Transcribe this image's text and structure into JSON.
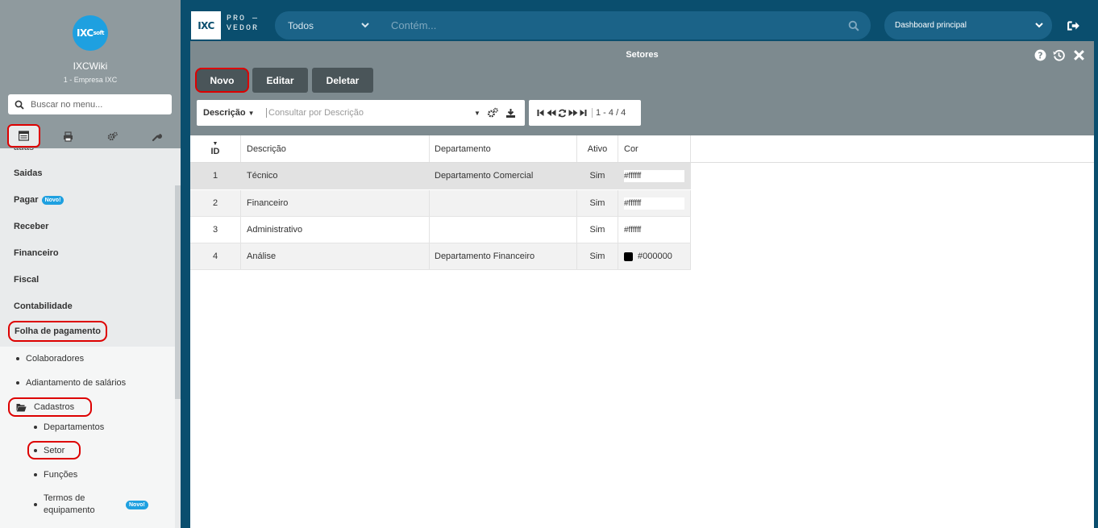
{
  "sidebar": {
    "logo_text": "IXC",
    "logo_suffix": "soft",
    "app_name": "IXCWiki",
    "company": "1 - Empresa IXC",
    "search_placeholder": "Buscar no menu...",
    "menu_items": [
      {
        "label": "Saidas"
      },
      {
        "label": "Pagar",
        "badge": "Novo!"
      },
      {
        "label": "Receber"
      },
      {
        "label": "Financeiro"
      },
      {
        "label": "Fiscal"
      },
      {
        "label": "Contabilidade"
      },
      {
        "label": "Folha de pagamento"
      }
    ],
    "folha_sub": [
      {
        "label": "Colaboradores"
      },
      {
        "label": "Adiantamento de salários"
      }
    ],
    "cadastros_label": "Cadastros",
    "cadastros_sub": [
      {
        "label": "Departamentos"
      },
      {
        "label": "Setor"
      },
      {
        "label": "Funções"
      },
      {
        "label": "Termos de equipamento",
        "badge": "Novo!"
      }
    ]
  },
  "header": {
    "brand": "IXC",
    "brand_sub_1": "PRO —",
    "brand_sub_2": "VEDOR",
    "scope": "Todos",
    "search_placeholder": "Contém...",
    "dashboard": "Dashboard principal"
  },
  "window": {
    "title": "Setores",
    "buttons": {
      "new": "Novo",
      "edit": "Editar",
      "delete": "Deletar"
    },
    "filter_field": "Descrição",
    "filter_placeholder": "Consultar por Descrição",
    "pager_text": "1 - 4 / 4"
  },
  "table": {
    "columns": [
      "ID",
      "Descrição",
      "Departamento",
      "Ativo",
      "Cor"
    ],
    "rows": [
      {
        "id": "1",
        "descricao": "Técnico",
        "departamento": "Departamento Comercial",
        "ativo": "Sim",
        "cor": "#ffffff"
      },
      {
        "id": "2",
        "descricao": "Financeiro",
        "departamento": "",
        "ativo": "Sim",
        "cor": "#ffffff"
      },
      {
        "id": "3",
        "descricao": "Administrativo",
        "departamento": "",
        "ativo": "Sim",
        "cor": "#ffffff"
      },
      {
        "id": "4",
        "descricao": "Análise",
        "departamento": "Departamento Financeiro",
        "ativo": "Sim",
        "cor": "#000000"
      }
    ]
  },
  "colors": {
    "topbar": "#0a4e6e",
    "accent": "#1ea0e0",
    "highlight": "#dd0000",
    "button": "#4a5559"
  }
}
